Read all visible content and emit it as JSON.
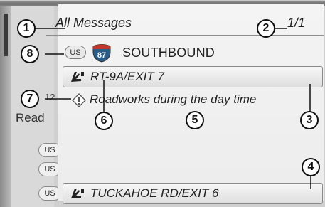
{
  "header": {
    "title": "All Messages",
    "page_indicator": "1/1"
  },
  "background_list": {
    "partial_text": "12",
    "section_label": "Read",
    "items": [
      {
        "label": "US"
      },
      {
        "label": "US"
      },
      {
        "label": "US"
      }
    ]
  },
  "route": {
    "country_badge": "US",
    "shield_number": "87",
    "direction": "SOUTHBOUND"
  },
  "messages": {
    "upper_exit": {
      "label": "RT-9A/EXIT 7",
      "icon": "exit-sign-icon"
    },
    "event": {
      "text": "Roadworks during the day time",
      "icon": "warning-diamond-icon"
    },
    "lower_exit": {
      "label": "TUCKAHOE RD/EXIT 6",
      "icon": "exit-sign-icon"
    }
  },
  "callouts": [
    "1",
    "2",
    "3",
    "4",
    "5",
    "6",
    "7",
    "8"
  ],
  "colors": {
    "panel_bg": "#f0f0f0",
    "screen_bg": "#cfcfcf",
    "shield_blue": "#2b5d8a",
    "shield_red": "#c0392b"
  }
}
